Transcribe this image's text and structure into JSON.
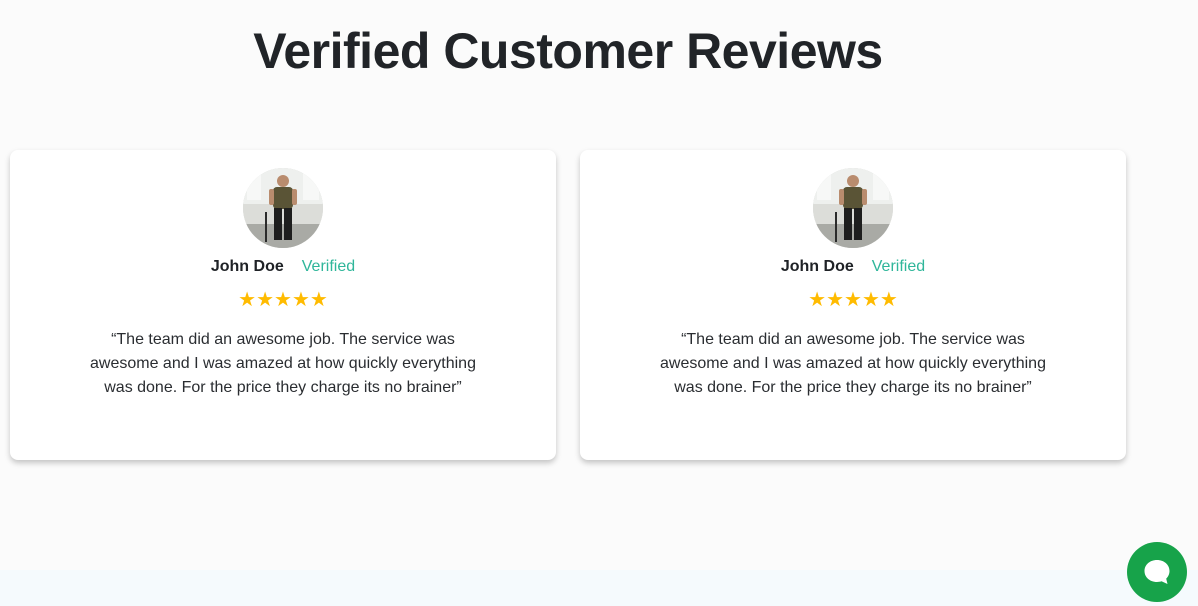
{
  "header": {
    "title": "Verified Customer Reviews"
  },
  "reviews": [
    {
      "name": "John Doe",
      "badge": "Verified",
      "rating": 5,
      "stars": "★★★★★",
      "quote": "“The team did an awesome job. The service was awesome and I was amazed at how quickly everything was done. For the price they charge its no brainer”"
    },
    {
      "name": "John Doe",
      "badge": "Verified",
      "rating": 5,
      "stars": "★★★★★",
      "quote": "“The team did an awesome job. The service was awesome and I was amazed at how quickly everything was done. For the price they charge its no brainer”"
    }
  ],
  "colors": {
    "title": "#212428",
    "verified": "#2fb69a",
    "star": "#ffbb00",
    "chat_button": "#17a34a"
  },
  "icons": {
    "chat": "chat-bubble-icon",
    "star": "star-icon"
  }
}
